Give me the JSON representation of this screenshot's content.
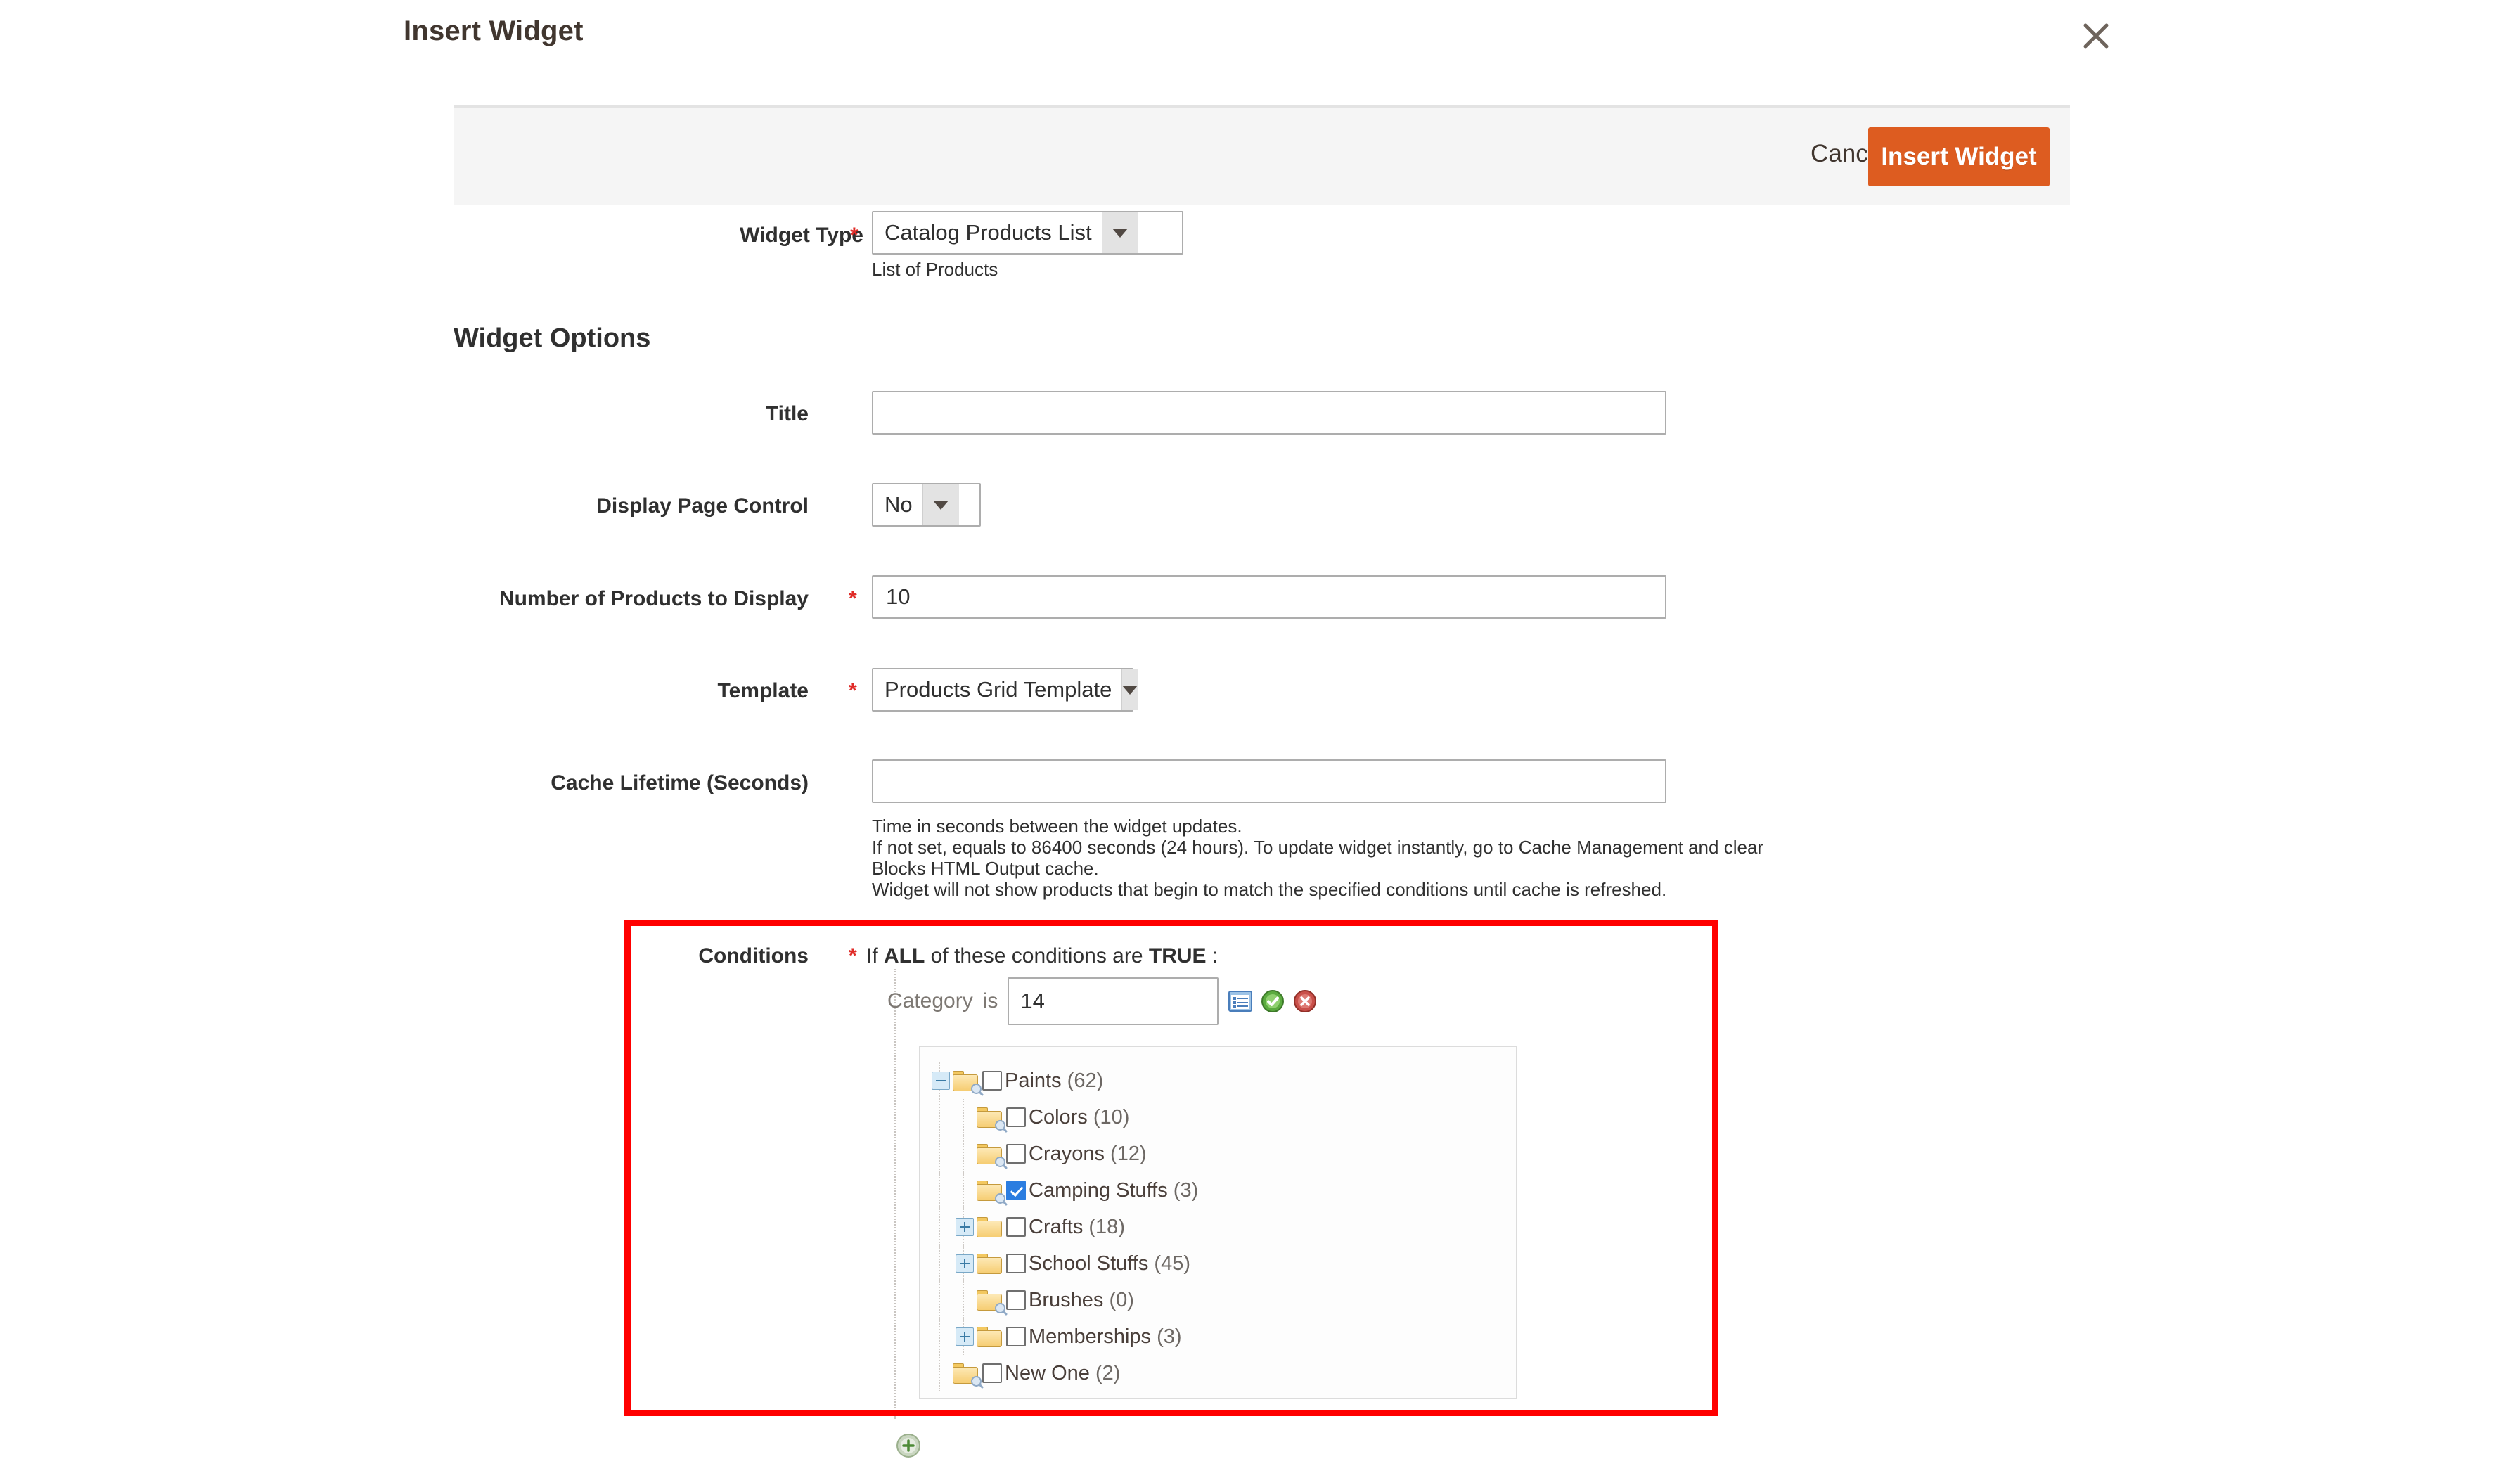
{
  "modal": {
    "title": "Insert Widget",
    "close_icon": "close-icon"
  },
  "toolbar": {
    "cancel_label": "Cancel",
    "insert_label": "Insert Widget",
    "accent_color": "#dd5c20"
  },
  "widget_type": {
    "label": "Widget Type",
    "required": "*",
    "value": "Catalog Products List",
    "note": "List of Products"
  },
  "section": {
    "heading": "Widget Options"
  },
  "fields": {
    "title": {
      "label": "Title",
      "value": "",
      "placeholder": ""
    },
    "display_page_control": {
      "label": "Display Page Control",
      "value": "No"
    },
    "number_of_products": {
      "label": "Number of Products to Display",
      "required": "*",
      "value": "10"
    },
    "template": {
      "label": "Template",
      "required": "*",
      "value": "Products Grid Template"
    },
    "cache_lifetime": {
      "label": "Cache Lifetime (Seconds)",
      "value": "",
      "note_line1": "Time in seconds between the widget updates.",
      "note_line2": "If not set, equals to 86400 seconds (24 hours). To update widget instantly, go to Cache Management and clear",
      "note_line3": "Blocks HTML Output cache.",
      "note_line4": "Widget will not show products that begin to match the specified conditions until cache is refreshed."
    }
  },
  "conditions": {
    "label": "Conditions",
    "required": "*",
    "intro_prefix": "If ",
    "intro_all": "ALL",
    "intro_middle": " of these conditions are ",
    "intro_true": "TRUE",
    "intro_suffix": " :",
    "row": {
      "attribute_label": "Category",
      "operator_label": "is",
      "value": "14",
      "chooser_icon": "list-chooser-icon",
      "apply_icon": "apply-check-icon",
      "remove_icon": "remove-cross-icon"
    },
    "add_icon": "add-condition-plus-icon",
    "highlight_color": "#ff0000",
    "tree": [
      {
        "name": "Paints",
        "count": "(62)",
        "depth": 0,
        "toggle": "minus",
        "checked": false,
        "search": true
      },
      {
        "name": "Colors",
        "count": "(10)",
        "depth": 1,
        "toggle": "none",
        "checked": false,
        "search": true
      },
      {
        "name": "Crayons",
        "count": "(12)",
        "depth": 1,
        "toggle": "none",
        "checked": false,
        "search": true
      },
      {
        "name": "Camping Stuffs",
        "count": "(3)",
        "depth": 1,
        "toggle": "none",
        "checked": true,
        "search": true
      },
      {
        "name": "Crafts",
        "count": "(18)",
        "depth": 1,
        "toggle": "plus",
        "checked": false,
        "search": false
      },
      {
        "name": "School Stuffs",
        "count": "(45)",
        "depth": 1,
        "toggle": "plus",
        "checked": false,
        "search": false
      },
      {
        "name": "Brushes",
        "count": "(0)",
        "depth": 1,
        "toggle": "none",
        "checked": false,
        "search": true
      },
      {
        "name": "Memberships",
        "count": "(3)",
        "depth": 1,
        "toggle": "plus",
        "checked": false,
        "search": false
      },
      {
        "name": "New One",
        "count": "(2)",
        "depth": 0,
        "toggle": "none",
        "checked": false,
        "search": true
      }
    ]
  }
}
